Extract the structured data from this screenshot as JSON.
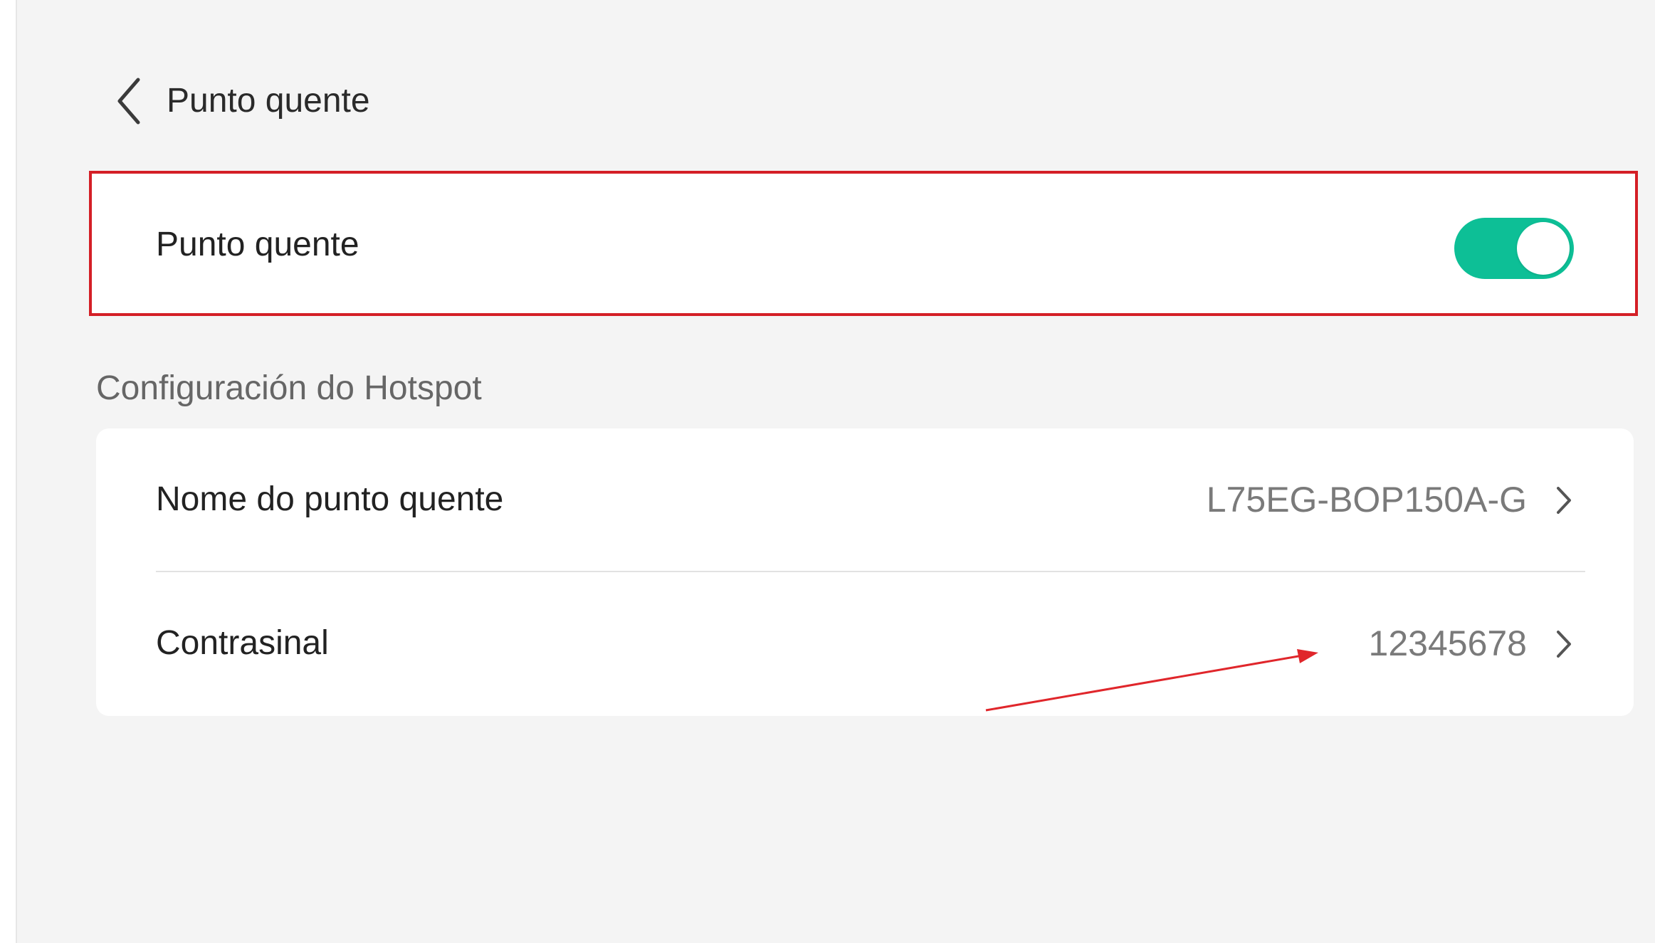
{
  "header": {
    "title": "Punto quente"
  },
  "hotspot_toggle": {
    "label": "Punto quente",
    "enabled": true
  },
  "section": {
    "title": "Configuración do Hotspot"
  },
  "settings": {
    "rows": [
      {
        "label": "Nome do punto quente",
        "value": "L75EG-BOP150A-G"
      },
      {
        "label": "Contrasinal",
        "value": "12345678"
      }
    ]
  },
  "colors": {
    "toggle_on": "#0dbf96",
    "highlight_border": "#d41f26",
    "background": "#f4f4f4"
  }
}
